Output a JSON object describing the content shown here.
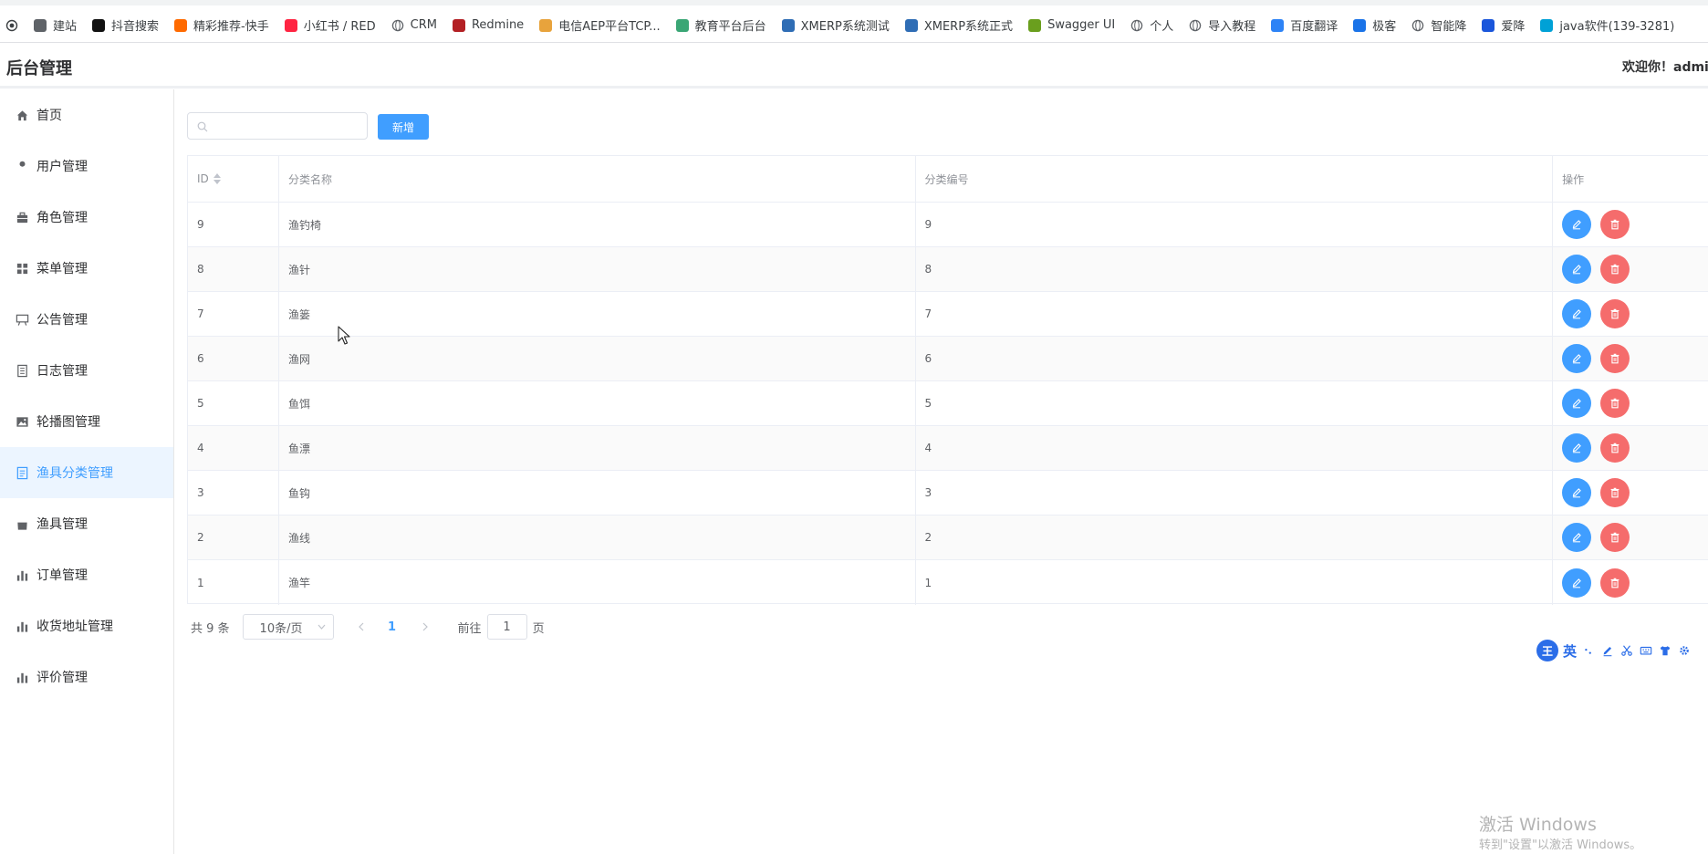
{
  "bookmarks": [
    {
      "label": "建站",
      "icon": "site-icon",
      "color": "#5f6368"
    },
    {
      "label": "抖音搜索",
      "icon": "douyin-icon",
      "color": "#111111"
    },
    {
      "label": "精彩推荐-快手",
      "icon": "kuaishou-icon",
      "color": "#ff6a00"
    },
    {
      "label": "小红书 / RED",
      "icon": "xiaohongshu-icon",
      "color": "#ff2442"
    },
    {
      "label": "CRM",
      "icon": "globe-icon",
      "color": "#5f6368"
    },
    {
      "label": "Redmine",
      "icon": "redmine-icon",
      "color": "#b32024"
    },
    {
      "label": "电信AEP平台TCP...",
      "icon": "aep-icon",
      "color": "#e8a33c"
    },
    {
      "label": "教育平台后台",
      "icon": "edu-icon",
      "color": "#3aa675"
    },
    {
      "label": "XMERP系统测试",
      "icon": "xmerp-icon",
      "color": "#2f6db5"
    },
    {
      "label": "XMERP系统正式",
      "icon": "xmerp-icon",
      "color": "#2f6db5"
    },
    {
      "label": "Swagger UI",
      "icon": "swagger-icon",
      "color": "#6a9f1e"
    },
    {
      "label": "个人",
      "icon": "globe-icon",
      "color": "#5f6368"
    },
    {
      "label": "导入教程",
      "icon": "globe-icon",
      "color": "#5f6368"
    },
    {
      "label": "百度翻译",
      "icon": "translate-icon",
      "color": "#2d83f6"
    },
    {
      "label": "极客",
      "icon": "geek-icon",
      "color": "#1a73e8"
    },
    {
      "label": "智能降",
      "icon": "globe-icon",
      "color": "#5f6368"
    },
    {
      "label": "爱降",
      "icon": "aijiang-icon",
      "color": "#1a56db"
    },
    {
      "label": "java软件(139-3281)",
      "icon": "bilibili-icon",
      "color": "#00a1d6"
    }
  ],
  "header": {
    "title": "后台管理",
    "welcome": "欢迎你！admin"
  },
  "sidebar": {
    "items": [
      {
        "label": "首页",
        "icon": "home-icon"
      },
      {
        "label": "用户管理",
        "icon": "user-icon"
      },
      {
        "label": "角色管理",
        "icon": "briefcase-icon"
      },
      {
        "label": "菜单管理",
        "icon": "grid-icon"
      },
      {
        "label": "公告管理",
        "icon": "notice-board-icon"
      },
      {
        "label": "日志管理",
        "icon": "log-icon"
      },
      {
        "label": "轮播图管理",
        "icon": "picture-icon"
      },
      {
        "label": "渔具分类管理",
        "icon": "document-icon",
        "active": true
      },
      {
        "label": "渔具管理",
        "icon": "shopping-bag-icon"
      },
      {
        "label": "订单管理",
        "icon": "bar-chart-icon"
      },
      {
        "label": "收货地址管理",
        "icon": "bar-chart-icon"
      },
      {
        "label": "评价管理",
        "icon": "bar-chart-icon"
      }
    ]
  },
  "toolbar": {
    "search_value": "",
    "add_label": "新增"
  },
  "table": {
    "headers": {
      "id": "ID",
      "name": "分类名称",
      "code": "分类编号",
      "actions": "操作"
    },
    "rows": [
      {
        "id": "9",
        "name": "渔钓椅",
        "code": "9"
      },
      {
        "id": "8",
        "name": "渔针",
        "code": "8"
      },
      {
        "id": "7",
        "name": "渔篓",
        "code": "7"
      },
      {
        "id": "6",
        "name": "渔网",
        "code": "6"
      },
      {
        "id": "5",
        "name": "鱼饵",
        "code": "5"
      },
      {
        "id": "4",
        "name": "鱼漂",
        "code": "4"
      },
      {
        "id": "3",
        "name": "鱼钩",
        "code": "3"
      },
      {
        "id": "2",
        "name": "渔线",
        "code": "2"
      },
      {
        "id": "1",
        "name": "渔竿",
        "code": "1"
      }
    ]
  },
  "pagination": {
    "total": "共 9 条",
    "page_size": "10条/页",
    "current_page": "1",
    "goto_prefix": "前往",
    "goto_value": "1",
    "goto_suffix": "页"
  },
  "ime": {
    "logo": "王",
    "lang": "英",
    "tools": [
      "punct-icon",
      "pen-icon",
      "scissors-icon",
      "keyboard-icon",
      "shirt-icon",
      "gear-icon"
    ]
  },
  "watermark": {
    "title": "激活 Windows",
    "subtitle": "转到\"设置\"以激活 Windows。"
  },
  "colors": {
    "primary": "#409eff",
    "danger": "#f56c6c",
    "active_bg": "#ecf5ff"
  }
}
